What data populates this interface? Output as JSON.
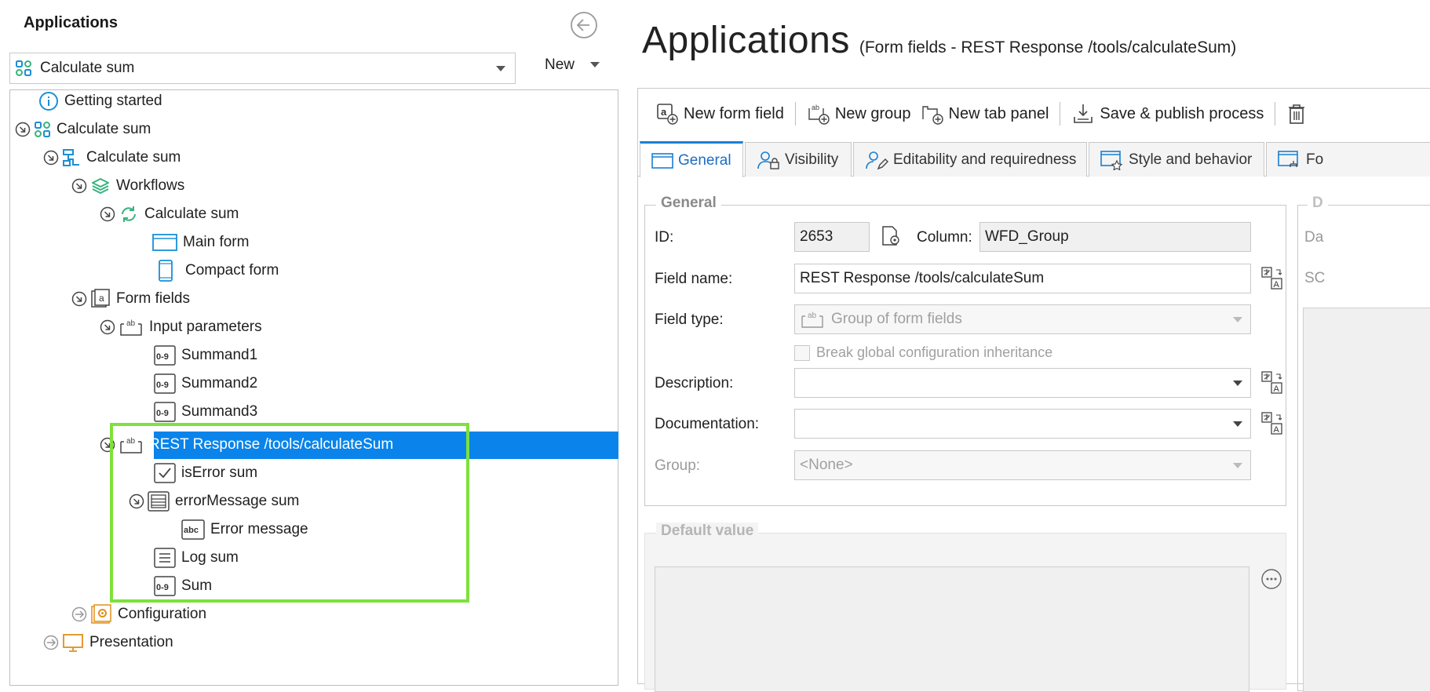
{
  "left": {
    "title": "Applications",
    "app_select": {
      "value": "Calculate sum"
    },
    "new_button": "New",
    "tree": [
      {
        "label": "Getting started"
      },
      {
        "label": "Calculate sum"
      },
      {
        "label": "Calculate sum"
      },
      {
        "label": "Workflows"
      },
      {
        "label": "Calculate sum"
      },
      {
        "label": "Main form"
      },
      {
        "label": "Compact form"
      },
      {
        "label": "Form fields"
      },
      {
        "label": "Input parameters"
      },
      {
        "label": "Summand1"
      },
      {
        "label": "Summand2"
      },
      {
        "label": "Summand3"
      },
      {
        "label": "REST Response /tools/calculateSum"
      },
      {
        "label": "isError sum"
      },
      {
        "label": "errorMessage sum"
      },
      {
        "label": "Error message"
      },
      {
        "label": "Log sum"
      },
      {
        "label": "Sum"
      },
      {
        "label": "Configuration"
      },
      {
        "label": "Presentation"
      }
    ]
  },
  "right": {
    "title": "Applications",
    "subtitle": "(Form fields - REST Response /tools/calculateSum)",
    "toolbar": {
      "new_form_field": "New form field",
      "new_group": "New group",
      "new_tab_panel": "New tab panel",
      "save_publish": "Save & publish process"
    },
    "tabs": {
      "general": "General",
      "visibility": "Visibility",
      "editability": "Editability and requiredness",
      "style": "Style and behavior",
      "fo": "Fo"
    },
    "general": {
      "group_title": "General",
      "id_label": "ID:",
      "id_value": "2653",
      "column_label": "Column:",
      "column_value": "WFD_Group",
      "field_name_label": "Field name:",
      "field_name_value": "REST Response /tools/calculateSum",
      "field_type_label": "Field type:",
      "field_type_value": "Group of form fields",
      "break_inheritance": "Break global configuration inheritance",
      "description_label": "Description:",
      "documentation_label": "Documentation:",
      "group_label": "Group:",
      "group_value": "<None>"
    },
    "default_value": {
      "title": "Default value"
    },
    "right_clip": {
      "t1": "D",
      "t2": "Da",
      "t3": "SC"
    }
  },
  "colors": {
    "selection": "#0a84ea",
    "highlight": "#7ee13c",
    "accent": "#1a7fd1"
  }
}
